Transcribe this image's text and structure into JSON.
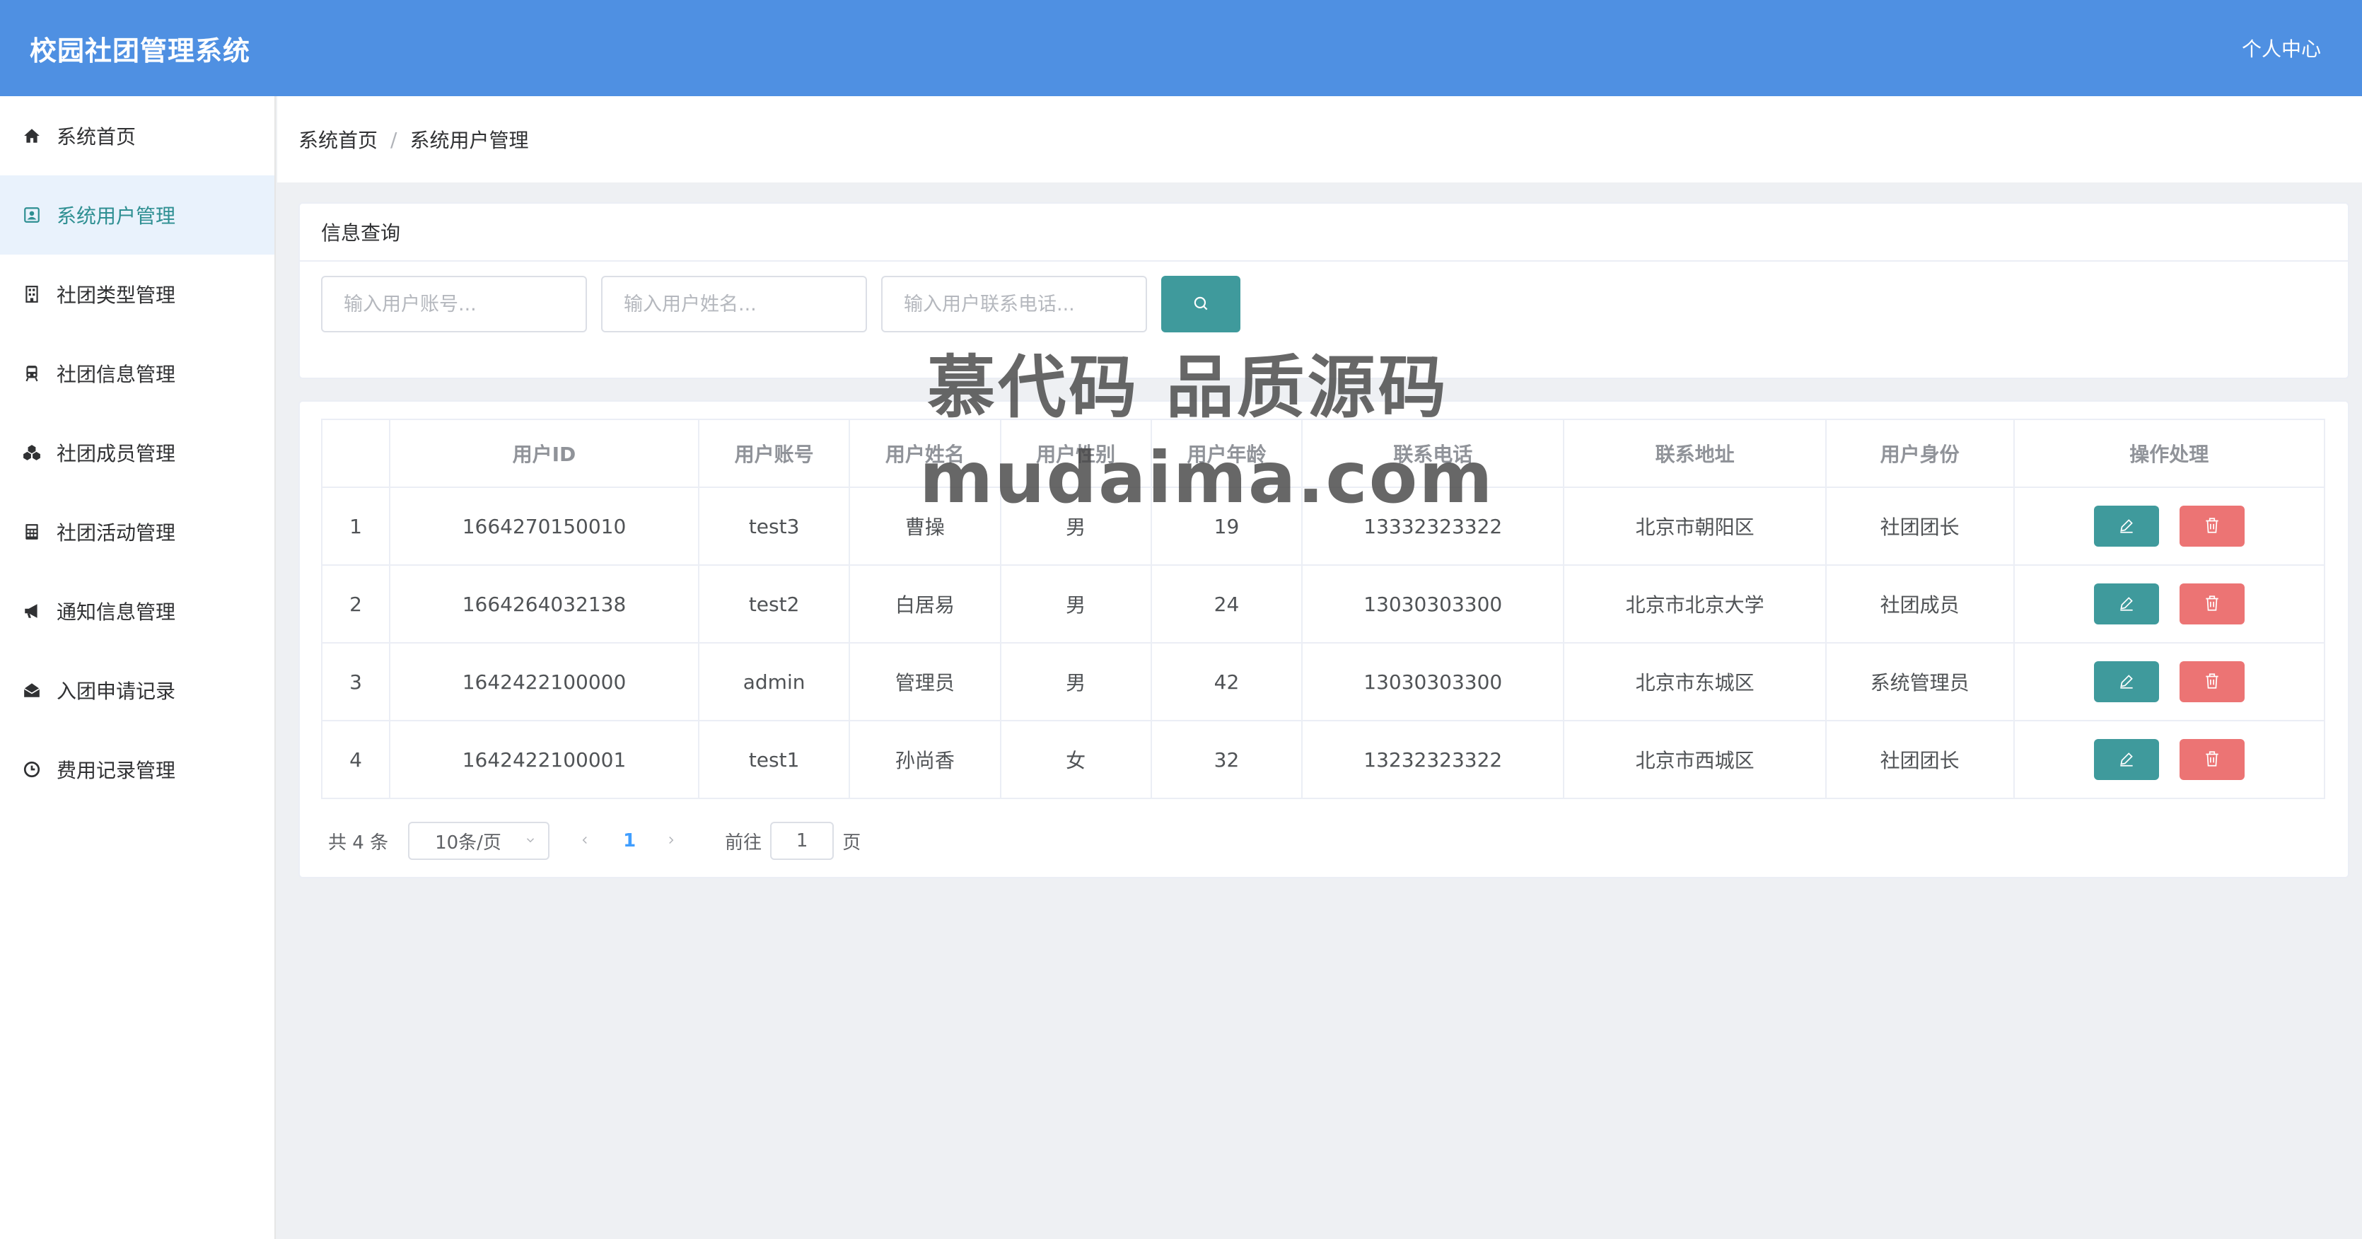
{
  "header": {
    "app_title": "校园社团管理系统",
    "profile_label": "个人中心"
  },
  "sidebar": {
    "items": [
      {
        "label": "系统首页",
        "icon": "home-icon"
      },
      {
        "label": "系统用户管理",
        "icon": "user-card-icon",
        "active": true
      },
      {
        "label": "社团类型管理",
        "icon": "building-icon"
      },
      {
        "label": "社团信息管理",
        "icon": "train-icon"
      },
      {
        "label": "社团成员管理",
        "icon": "cubes-icon"
      },
      {
        "label": "社团活动管理",
        "icon": "calculator-icon"
      },
      {
        "label": "通知信息管理",
        "icon": "bullhorn-icon"
      },
      {
        "label": "入团申请记录",
        "icon": "envelope-open-icon"
      },
      {
        "label": "费用记录管理",
        "icon": "clock-icon"
      }
    ]
  },
  "breadcrumb": {
    "home": "系统首页",
    "separator": "/",
    "current": "系统用户管理"
  },
  "query": {
    "title": "信息查询",
    "account_placeholder": "输入用户账号...",
    "name_placeholder": "输入用户姓名...",
    "phone_placeholder": "输入用户联系电话...",
    "search_icon": "search-icon"
  },
  "table": {
    "columns": [
      "",
      "用户ID",
      "用户账号",
      "用户姓名",
      "用户性别",
      "用户年龄",
      "联系电话",
      "联系地址",
      "用户身份",
      "操作处理"
    ],
    "rows": [
      [
        "1",
        "1664270150010",
        "test3",
        "曹操",
        "男",
        "19",
        "13332323322",
        "北京市朝阳区",
        "社团团长"
      ],
      [
        "2",
        "1664264032138",
        "test2",
        "白居易",
        "男",
        "24",
        "13030303300",
        "北京市北京大学",
        "社团成员"
      ],
      [
        "3",
        "1642422100000",
        "admin",
        "管理员",
        "男",
        "42",
        "13030303300",
        "北京市东城区",
        "系统管理员"
      ],
      [
        "4",
        "1642422100001",
        "test1",
        "孙尚香",
        "女",
        "32",
        "13232323322",
        "北京市西城区",
        "社团团长"
      ]
    ]
  },
  "pagination": {
    "total_text": "共 4 条",
    "page_size": "10条/页",
    "current_page": "1",
    "goto_label": "前往",
    "goto_value": "1",
    "page_unit": "页"
  },
  "watermark": {
    "line1": "慕代码 品质源码",
    "line2": "mudaima.com"
  },
  "colors": {
    "header_bg": "#4f90e2",
    "primary_teal": "#3f9a9c",
    "danger": "#ec7474",
    "active_bg": "#e9f2fc"
  }
}
